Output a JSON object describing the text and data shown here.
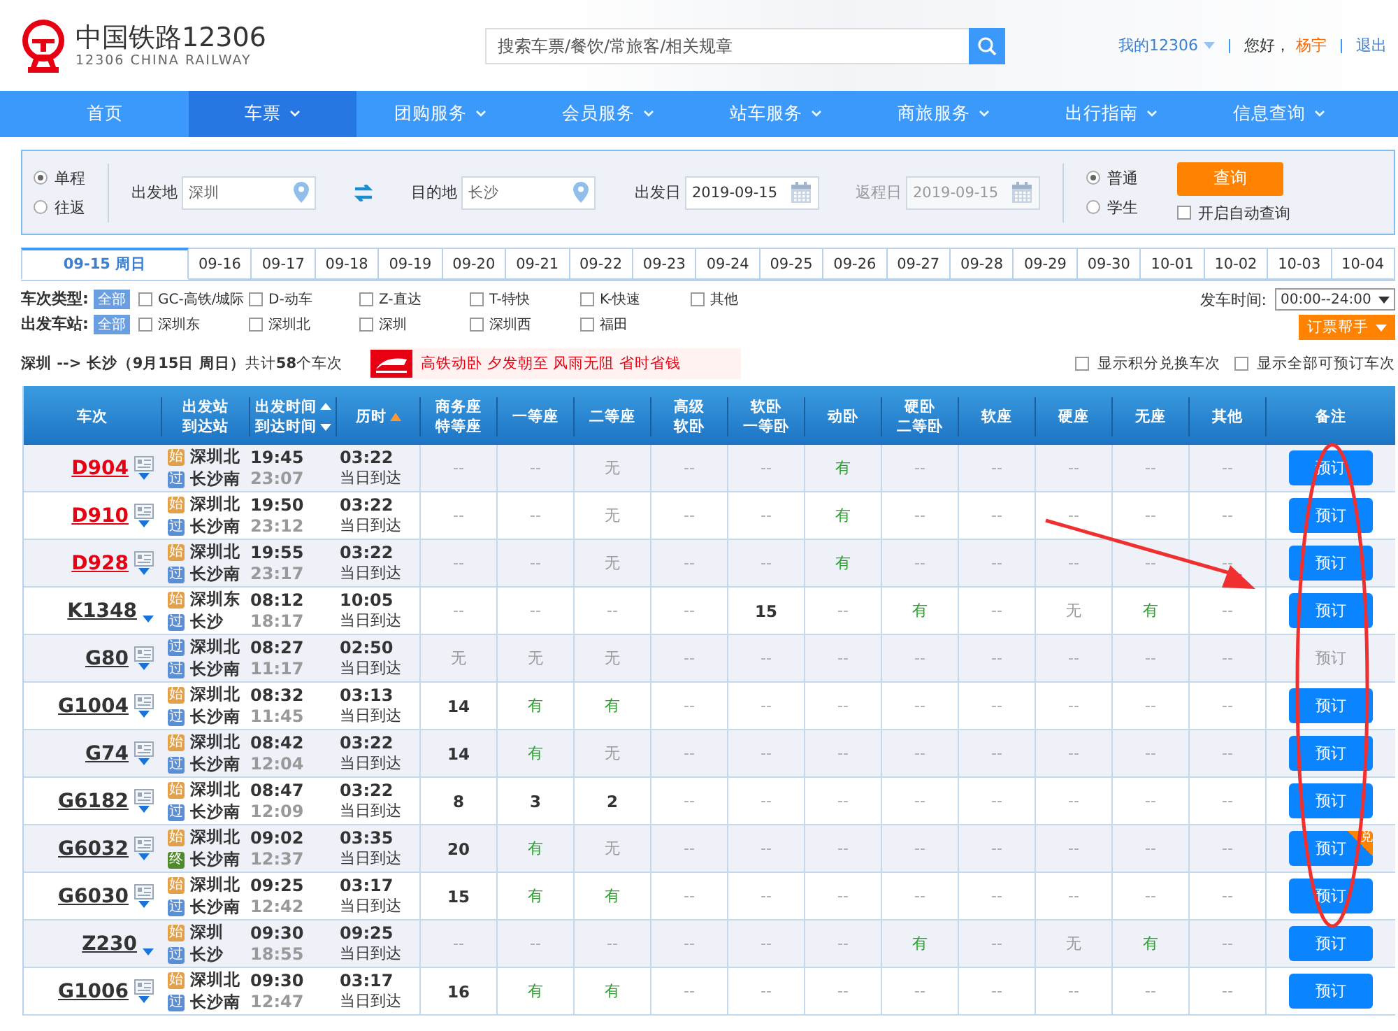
{
  "header": {
    "logo_title": "中国铁路12306",
    "logo_subtitle": "12306 CHINA RAILWAY",
    "search": {
      "placeholder": "搜索车票/餐饮/常旅客/相关规章"
    },
    "my_link": "我的12306",
    "greeting": "您好，",
    "user": "杨宇",
    "logout": "退出"
  },
  "nav": [
    {
      "label": "首页",
      "selected": false,
      "has_menu": false
    },
    {
      "label": "车票",
      "selected": true,
      "has_menu": true
    },
    {
      "label": "团购服务",
      "selected": false,
      "has_menu": true
    },
    {
      "label": "会员服务",
      "selected": false,
      "has_menu": true
    },
    {
      "label": "站车服务",
      "selected": false,
      "has_menu": true
    },
    {
      "label": "商旅服务",
      "selected": false,
      "has_menu": true
    },
    {
      "label": "出行指南",
      "selected": false,
      "has_menu": true
    },
    {
      "label": "信息查询",
      "selected": false,
      "has_menu": true
    }
  ],
  "query": {
    "trip_types": [
      {
        "label": "单程",
        "selected": true
      },
      {
        "label": "往返",
        "selected": false
      }
    ],
    "fields": [
      {
        "label": "出发地",
        "value": "深圳",
        "kind": "place",
        "disabled": false
      },
      {
        "label": "目的地",
        "value": "长沙",
        "kind": "place",
        "disabled": false
      },
      {
        "label": "出发日",
        "value": "2019-09-15",
        "kind": "date",
        "disabled": false
      },
      {
        "label": "返程日",
        "value": "2019-09-15",
        "kind": "date",
        "disabled": true
      }
    ],
    "passenger_types": [
      {
        "label": "普通",
        "selected": true
      },
      {
        "label": "学生",
        "selected": false
      }
    ],
    "search_button": "查询",
    "auto_query": {
      "label": "开启自动查询",
      "checked": false
    }
  },
  "date_tabs": [
    {
      "label": "09-15 周日",
      "selected": true
    },
    {
      "label": "09-16",
      "selected": false
    },
    {
      "label": "09-17",
      "selected": false
    },
    {
      "label": "09-18",
      "selected": false
    },
    {
      "label": "09-19",
      "selected": false
    },
    {
      "label": "09-20",
      "selected": false
    },
    {
      "label": "09-21",
      "selected": false
    },
    {
      "label": "09-22",
      "selected": false
    },
    {
      "label": "09-23",
      "selected": false
    },
    {
      "label": "09-24",
      "selected": false
    },
    {
      "label": "09-25",
      "selected": false
    },
    {
      "label": "09-26",
      "selected": false
    },
    {
      "label": "09-27",
      "selected": false
    },
    {
      "label": "09-28",
      "selected": false
    },
    {
      "label": "09-29",
      "selected": false
    },
    {
      "label": "09-30",
      "selected": false
    },
    {
      "label": "10-01",
      "selected": false
    },
    {
      "label": "10-02",
      "selected": false
    },
    {
      "label": "10-03",
      "selected": false
    },
    {
      "label": "10-04",
      "selected": false
    }
  ],
  "filters": [
    {
      "label": "车次类型:",
      "all": "全部",
      "options": [
        {
          "label": "GC-高铁/城际",
          "checked": false
        },
        {
          "label": "D-动车",
          "checked": false
        },
        {
          "label": "Z-直达",
          "checked": false
        },
        {
          "label": "T-特快",
          "checked": false
        },
        {
          "label": "K-快速",
          "checked": false
        },
        {
          "label": "其他",
          "checked": false
        }
      ]
    },
    {
      "label": "出发车站:",
      "all": "全部",
      "options": [
        {
          "label": "深圳东",
          "checked": false
        },
        {
          "label": "深圳北",
          "checked": false
        },
        {
          "label": "深圳",
          "checked": false
        },
        {
          "label": "深圳西",
          "checked": false
        },
        {
          "label": "福田",
          "checked": false
        }
      ]
    }
  ],
  "time_filter": {
    "label": "发车时间:",
    "value": "00:00--24:00"
  },
  "helper_button": "订票帮手",
  "summary": {
    "route": "深圳 --> 长沙（9月15日  周日）",
    "count": "共计**58**个车次"
  },
  "promo": "高铁动卧 夕发朝至 风雨无阻 省时省钱",
  "options": [
    {
      "label": "显示积分兑换车次",
      "checked": false
    },
    {
      "label": "显示全部可预订车次",
      "checked": false
    }
  ],
  "table": {
    "columns": [
      {
        "lines": [
          "车次"
        ],
        "kind": "plain"
      },
      {
        "lines": [
          "出发站",
          "到达站"
        ],
        "kind": "plain"
      },
      {
        "lines": [
          "出发时间",
          "到达时间"
        ],
        "kind": "sortboth"
      },
      {
        "lines": [
          "历时"
        ],
        "kind": "sortasc"
      },
      {
        "lines": [
          "商务座",
          "特等座"
        ],
        "kind": "plain"
      },
      {
        "lines": [
          "一等座"
        ],
        "kind": "plain"
      },
      {
        "lines": [
          "二等座"
        ],
        "kind": "plain"
      },
      {
        "lines": [
          "高级",
          "软卧"
        ],
        "kind": "plain"
      },
      {
        "lines": [
          "软卧",
          "一等卧"
        ],
        "kind": "plain"
      },
      {
        "lines": [
          "动卧"
        ],
        "kind": "plain"
      },
      {
        "lines": [
          "硬卧",
          "二等卧"
        ],
        "kind": "plain"
      },
      {
        "lines": [
          "软座"
        ],
        "kind": "plain"
      },
      {
        "lines": [
          "硬座"
        ],
        "kind": "plain"
      },
      {
        "lines": [
          "无座"
        ],
        "kind": "plain"
      },
      {
        "lines": [
          "其他"
        ],
        "kind": "plain"
      },
      {
        "lines": [
          "备注"
        ],
        "kind": "plain"
      }
    ],
    "rows": [
      {
        "train": "D904",
        "color": "#e60012",
        "has_detail": true,
        "from": {
          "name": "深圳北",
          "mark": "始",
          "kind": "start"
        },
        "to": {
          "name": "长沙南",
          "mark": "过",
          "kind": "pass"
        },
        "depart": "19:45",
        "arrive": "23:07",
        "duration": "03:22",
        "arrival_day": "当日到达",
        "seats": [
          {
            "v": "--",
            "kind": "none"
          },
          {
            "v": "--",
            "kind": "none"
          },
          {
            "v": "无",
            "kind": "sold"
          },
          {
            "v": "--",
            "kind": "none"
          },
          {
            "v": "--",
            "kind": "none"
          },
          {
            "v": "有",
            "kind": "available"
          },
          {
            "v": "--",
            "kind": "none"
          },
          {
            "v": "--",
            "kind": "none"
          },
          {
            "v": "--",
            "kind": "none"
          },
          {
            "v": "--",
            "kind": "none"
          },
          {
            "v": "--",
            "kind": "none"
          }
        ],
        "book": {
          "label": "预订",
          "disabled": false
        }
      },
      {
        "train": "D910",
        "color": "#e60012",
        "has_detail": true,
        "from": {
          "name": "深圳北",
          "mark": "始",
          "kind": "start"
        },
        "to": {
          "name": "长沙南",
          "mark": "过",
          "kind": "pass"
        },
        "depart": "19:50",
        "arrive": "23:12",
        "duration": "03:22",
        "arrival_day": "当日到达",
        "seats": [
          {
            "v": "--",
            "kind": "none"
          },
          {
            "v": "--",
            "kind": "none"
          },
          {
            "v": "无",
            "kind": "sold"
          },
          {
            "v": "--",
            "kind": "none"
          },
          {
            "v": "--",
            "kind": "none"
          },
          {
            "v": "有",
            "kind": "available"
          },
          {
            "v": "--",
            "kind": "none"
          },
          {
            "v": "--",
            "kind": "none"
          },
          {
            "v": "--",
            "kind": "none"
          },
          {
            "v": "--",
            "kind": "none"
          },
          {
            "v": "--",
            "kind": "none"
          }
        ],
        "book": {
          "label": "预订",
          "disabled": false
        }
      },
      {
        "train": "D928",
        "color": "#e60012",
        "has_detail": true,
        "from": {
          "name": "深圳北",
          "mark": "始",
          "kind": "start"
        },
        "to": {
          "name": "长沙南",
          "mark": "过",
          "kind": "pass"
        },
        "depart": "19:55",
        "arrive": "23:17",
        "duration": "03:22",
        "arrival_day": "当日到达",
        "seats": [
          {
            "v": "--",
            "kind": "none"
          },
          {
            "v": "--",
            "kind": "none"
          },
          {
            "v": "无",
            "kind": "sold"
          },
          {
            "v": "--",
            "kind": "none"
          },
          {
            "v": "--",
            "kind": "none"
          },
          {
            "v": "有",
            "kind": "available"
          },
          {
            "v": "--",
            "kind": "none"
          },
          {
            "v": "--",
            "kind": "none"
          },
          {
            "v": "--",
            "kind": "none"
          },
          {
            "v": "--",
            "kind": "none"
          },
          {
            "v": "--",
            "kind": "none"
          }
        ],
        "book": {
          "label": "预订",
          "disabled": false
        }
      },
      {
        "train": "K1348",
        "color": "#333333",
        "has_detail": false,
        "from": {
          "name": "深圳东",
          "mark": "始",
          "kind": "start"
        },
        "to": {
          "name": "长沙",
          "mark": "过",
          "kind": "pass"
        },
        "depart": "08:12",
        "arrive": "18:17",
        "duration": "10:05",
        "arrival_day": "当日到达",
        "seats": [
          {
            "v": "--",
            "kind": "none"
          },
          {
            "v": "--",
            "kind": "none"
          },
          {
            "v": "--",
            "kind": "none"
          },
          {
            "v": "--",
            "kind": "none"
          },
          {
            "v": "15",
            "kind": "count"
          },
          {
            "v": "--",
            "kind": "none"
          },
          {
            "v": "有",
            "kind": "available"
          },
          {
            "v": "--",
            "kind": "none"
          },
          {
            "v": "无",
            "kind": "sold"
          },
          {
            "v": "有",
            "kind": "available"
          },
          {
            "v": "--",
            "kind": "none"
          }
        ],
        "book": {
          "label": "预订",
          "disabled": false
        }
      },
      {
        "train": "G80",
        "color": "#333333",
        "has_detail": true,
        "from": {
          "name": "深圳北",
          "mark": "过",
          "kind": "pass"
        },
        "to": {
          "name": "长沙南",
          "mark": "过",
          "kind": "pass"
        },
        "depart": "08:27",
        "arrive": "11:17",
        "duration": "02:50",
        "arrival_day": "当日到达",
        "seats": [
          {
            "v": "无",
            "kind": "sold"
          },
          {
            "v": "无",
            "kind": "sold"
          },
          {
            "v": "无",
            "kind": "sold"
          },
          {
            "v": "--",
            "kind": "none"
          },
          {
            "v": "--",
            "kind": "none"
          },
          {
            "v": "--",
            "kind": "none"
          },
          {
            "v": "--",
            "kind": "none"
          },
          {
            "v": "--",
            "kind": "none"
          },
          {
            "v": "--",
            "kind": "none"
          },
          {
            "v": "--",
            "kind": "none"
          },
          {
            "v": "--",
            "kind": "none"
          }
        ],
        "book": {
          "label": "预订",
          "disabled": true
        }
      },
      {
        "train": "G1004",
        "color": "#333333",
        "has_detail": true,
        "from": {
          "name": "深圳北",
          "mark": "始",
          "kind": "start"
        },
        "to": {
          "name": "长沙南",
          "mark": "过",
          "kind": "pass"
        },
        "depart": "08:32",
        "arrive": "11:45",
        "duration": "03:13",
        "arrival_day": "当日到达",
        "seats": [
          {
            "v": "14",
            "kind": "count"
          },
          {
            "v": "有",
            "kind": "available"
          },
          {
            "v": "有",
            "kind": "available"
          },
          {
            "v": "--",
            "kind": "none"
          },
          {
            "v": "--",
            "kind": "none"
          },
          {
            "v": "--",
            "kind": "none"
          },
          {
            "v": "--",
            "kind": "none"
          },
          {
            "v": "--",
            "kind": "none"
          },
          {
            "v": "--",
            "kind": "none"
          },
          {
            "v": "--",
            "kind": "none"
          },
          {
            "v": "--",
            "kind": "none"
          }
        ],
        "book": {
          "label": "预订",
          "disabled": false
        }
      },
      {
        "train": "G74",
        "color": "#333333",
        "has_detail": true,
        "from": {
          "name": "深圳北",
          "mark": "始",
          "kind": "start"
        },
        "to": {
          "name": "长沙南",
          "mark": "过",
          "kind": "pass"
        },
        "depart": "08:42",
        "arrive": "12:04",
        "duration": "03:22",
        "arrival_day": "当日到达",
        "seats": [
          {
            "v": "14",
            "kind": "count"
          },
          {
            "v": "有",
            "kind": "available"
          },
          {
            "v": "无",
            "kind": "sold"
          },
          {
            "v": "--",
            "kind": "none"
          },
          {
            "v": "--",
            "kind": "none"
          },
          {
            "v": "--",
            "kind": "none"
          },
          {
            "v": "--",
            "kind": "none"
          },
          {
            "v": "--",
            "kind": "none"
          },
          {
            "v": "--",
            "kind": "none"
          },
          {
            "v": "--",
            "kind": "none"
          },
          {
            "v": "--",
            "kind": "none"
          }
        ],
        "book": {
          "label": "预订",
          "disabled": false
        }
      },
      {
        "train": "G6182",
        "color": "#333333",
        "has_detail": true,
        "from": {
          "name": "深圳北",
          "mark": "始",
          "kind": "start"
        },
        "to": {
          "name": "长沙南",
          "mark": "过",
          "kind": "pass"
        },
        "depart": "08:47",
        "arrive": "12:09",
        "duration": "03:22",
        "arrival_day": "当日到达",
        "seats": [
          {
            "v": "8",
            "kind": "count"
          },
          {
            "v": "3",
            "kind": "count"
          },
          {
            "v": "2",
            "kind": "count"
          },
          {
            "v": "--",
            "kind": "none"
          },
          {
            "v": "--",
            "kind": "none"
          },
          {
            "v": "--",
            "kind": "none"
          },
          {
            "v": "--",
            "kind": "none"
          },
          {
            "v": "--",
            "kind": "none"
          },
          {
            "v": "--",
            "kind": "none"
          },
          {
            "v": "--",
            "kind": "none"
          },
          {
            "v": "--",
            "kind": "none"
          }
        ],
        "book": {
          "label": "预订",
          "disabled": false
        }
      },
      {
        "train": "G6032",
        "color": "#333333",
        "has_detail": true,
        "from": {
          "name": "深圳北",
          "mark": "始",
          "kind": "start"
        },
        "to": {
          "name": "长沙南",
          "mark": "终",
          "kind": "end"
        },
        "depart": "09:02",
        "arrive": "12:37",
        "duration": "03:35",
        "arrival_day": "当日到达",
        "seats": [
          {
            "v": "20",
            "kind": "count"
          },
          {
            "v": "有",
            "kind": "available"
          },
          {
            "v": "无",
            "kind": "sold"
          },
          {
            "v": "--",
            "kind": "none"
          },
          {
            "v": "--",
            "kind": "none"
          },
          {
            "v": "--",
            "kind": "none"
          },
          {
            "v": "--",
            "kind": "none"
          },
          {
            "v": "--",
            "kind": "none"
          },
          {
            "v": "--",
            "kind": "none"
          },
          {
            "v": "--",
            "kind": "none"
          },
          {
            "v": "--",
            "kind": "none"
          }
        ],
        "book": {
          "label": "预订",
          "disabled": false,
          "badge": "兑"
        }
      },
      {
        "train": "G6030",
        "color": "#333333",
        "has_detail": true,
        "from": {
          "name": "深圳北",
          "mark": "始",
          "kind": "start"
        },
        "to": {
          "name": "长沙南",
          "mark": "过",
          "kind": "pass"
        },
        "depart": "09:25",
        "arrive": "12:42",
        "duration": "03:17",
        "arrival_day": "当日到达",
        "seats": [
          {
            "v": "15",
            "kind": "count"
          },
          {
            "v": "有",
            "kind": "available"
          },
          {
            "v": "有",
            "kind": "available"
          },
          {
            "v": "--",
            "kind": "none"
          },
          {
            "v": "--",
            "kind": "none"
          },
          {
            "v": "--",
            "kind": "none"
          },
          {
            "v": "--",
            "kind": "none"
          },
          {
            "v": "--",
            "kind": "none"
          },
          {
            "v": "--",
            "kind": "none"
          },
          {
            "v": "--",
            "kind": "none"
          },
          {
            "v": "--",
            "kind": "none"
          }
        ],
        "book": {
          "label": "预订",
          "disabled": false
        }
      },
      {
        "train": "Z230",
        "color": "#333333",
        "has_detail": false,
        "from": {
          "name": "深圳",
          "mark": "始",
          "kind": "start"
        },
        "to": {
          "name": "长沙",
          "mark": "过",
          "kind": "pass"
        },
        "depart": "09:30",
        "arrive": "18:55",
        "duration": "09:25",
        "arrival_day": "当日到达",
        "seats": [
          {
            "v": "--",
            "kind": "none"
          },
          {
            "v": "--",
            "kind": "none"
          },
          {
            "v": "--",
            "kind": "none"
          },
          {
            "v": "--",
            "kind": "none"
          },
          {
            "v": "--",
            "kind": "none"
          },
          {
            "v": "--",
            "kind": "none"
          },
          {
            "v": "有",
            "kind": "available"
          },
          {
            "v": "--",
            "kind": "none"
          },
          {
            "v": "无",
            "kind": "sold"
          },
          {
            "v": "有",
            "kind": "available"
          },
          {
            "v": "--",
            "kind": "none"
          }
        ],
        "book": {
          "label": "预订",
          "disabled": false
        }
      },
      {
        "train": "G1006",
        "color": "#333333",
        "has_detail": true,
        "from": {
          "name": "深圳北",
          "mark": "始",
          "kind": "start"
        },
        "to": {
          "name": "长沙南",
          "mark": "过",
          "kind": "pass"
        },
        "depart": "09:30",
        "arrive": "12:47",
        "duration": "03:17",
        "arrival_day": "当日到达",
        "seats": [
          {
            "v": "16",
            "kind": "count"
          },
          {
            "v": "有",
            "kind": "available"
          },
          {
            "v": "有",
            "kind": "available"
          },
          {
            "v": "--",
            "kind": "none"
          },
          {
            "v": "--",
            "kind": "none"
          },
          {
            "v": "--",
            "kind": "none"
          },
          {
            "v": "--",
            "kind": "none"
          },
          {
            "v": "--",
            "kind": "none"
          },
          {
            "v": "--",
            "kind": "none"
          },
          {
            "v": "--",
            "kind": "none"
          },
          {
            "v": "--",
            "kind": "none"
          }
        ],
        "book": {
          "label": "预订",
          "disabled": false
        }
      }
    ]
  }
}
